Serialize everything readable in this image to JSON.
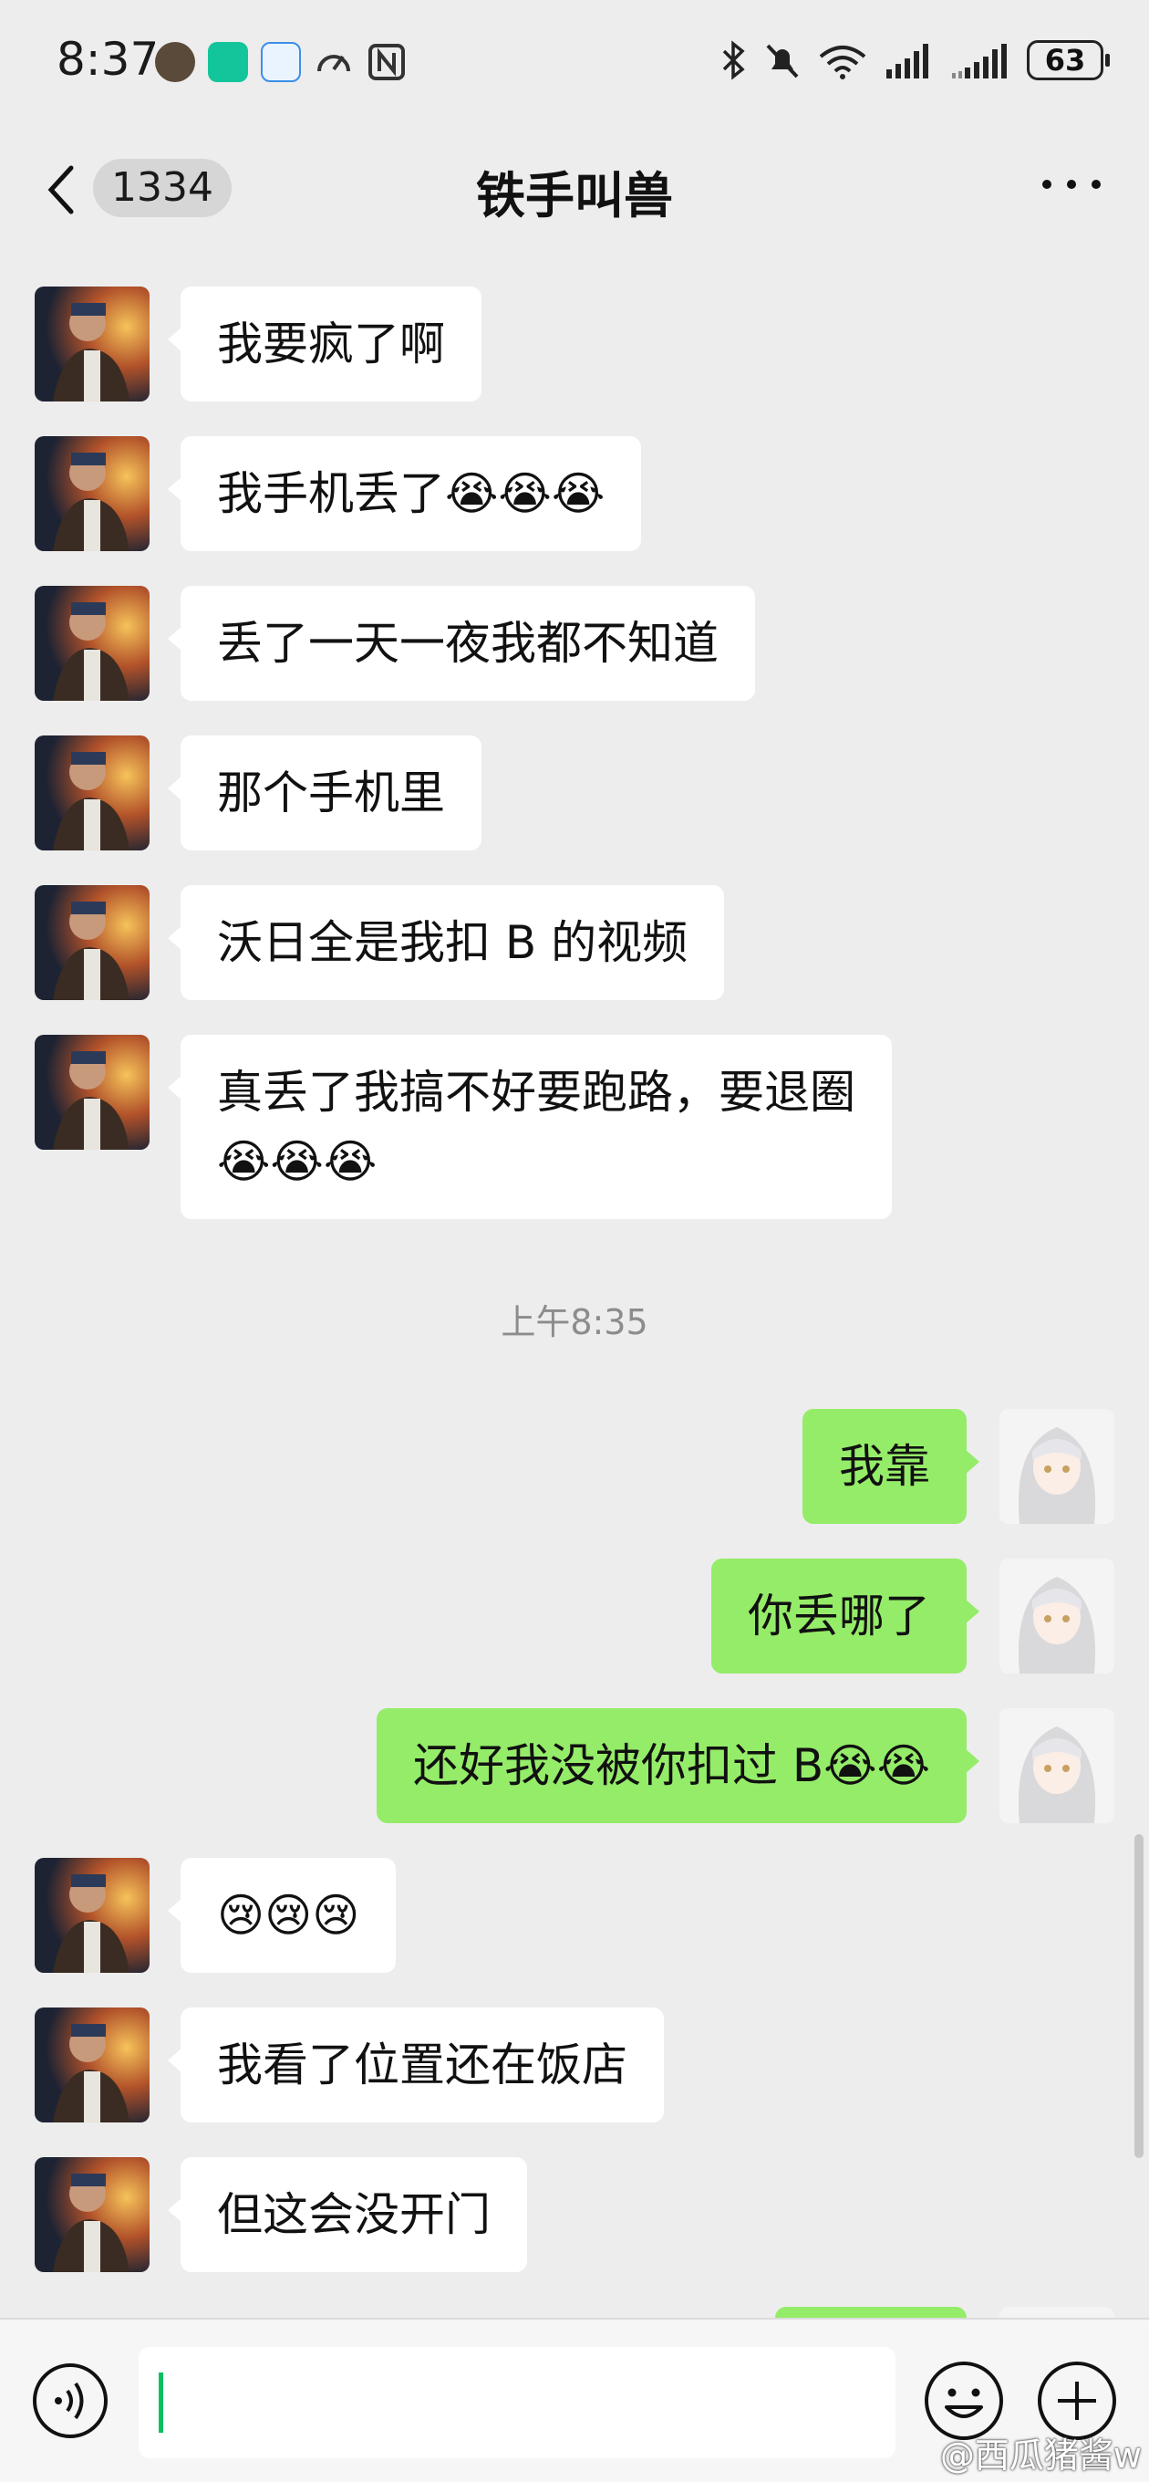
{
  "status_bar": {
    "time": "8:37",
    "battery": "63"
  },
  "header": {
    "back_icon": "chevron-left-icon",
    "unread_count": "1334",
    "title": "铁手叫兽",
    "more_icon": "more-dots-icon"
  },
  "messages": [
    {
      "side": "in",
      "text": "我要疯了啊"
    },
    {
      "side": "in",
      "text": "我手机丢了😭😭😭"
    },
    {
      "side": "in",
      "text": "丢了一天一夜我都不知道"
    },
    {
      "side": "in",
      "text": "那个手机里"
    },
    {
      "side": "in",
      "text": "沃日全是我扣 B 的视频"
    },
    {
      "side": "in",
      "text": "真丢了我搞不好要跑路，要退圈\n😭😭😭"
    },
    {
      "side": "out",
      "text": "我靠"
    },
    {
      "side": "out",
      "text": "你丢哪了"
    },
    {
      "side": "out",
      "text": "还好我没被你扣过 B😭😭"
    },
    {
      "side": "in",
      "text": "😢😢😢"
    },
    {
      "side": "in",
      "text": "我看了位置还在饭店"
    },
    {
      "side": "in",
      "text": "但这会没开门"
    }
  ],
  "time_divider": "上午8:35",
  "input_bar": {
    "voice_icon": "voice-icon",
    "emoji_icon": "emoji-icon",
    "plus_icon": "plus-circle-icon",
    "input_value": ""
  },
  "watermark": "@西瓜猪酱w",
  "colors": {
    "background": "#ededed",
    "incoming_bubble": "#ffffff",
    "outgoing_bubble": "#95ec69",
    "cursor": "#07c160"
  }
}
